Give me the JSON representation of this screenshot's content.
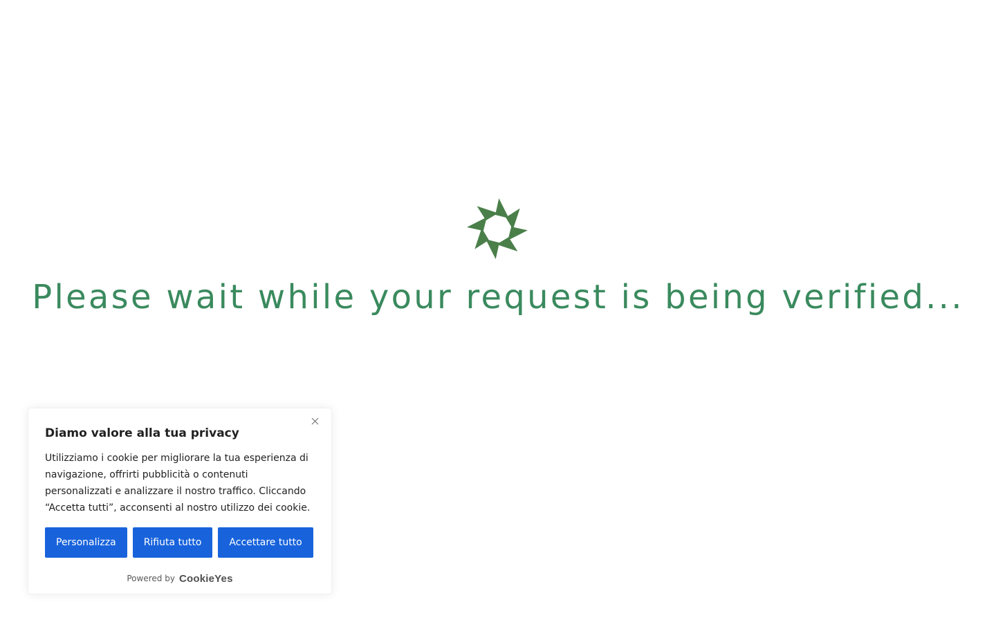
{
  "colors": {
    "accent_green": "#3a8a5e",
    "loader_green": "#4a7f4a",
    "button_blue": "#1863dc",
    "text_dark": "#212121",
    "close_gray": "#757575"
  },
  "loader": {
    "icon": "spinner-icon"
  },
  "verification": {
    "message": "Please wait while your request is being verified..."
  },
  "cookie_banner": {
    "title": "Diamo valore alla tua privacy",
    "description": "Utilizziamo i cookie per migliorare la tua esperienza di navigazione, offrirti pubblicità o contenuti personalizzati e analizzare il nostro traffico. Cliccando “Accetta tutti”, acconsenti al nostro utilizzo dei cookie.",
    "close_icon": "close-icon",
    "buttons": {
      "customize": "Personalizza",
      "reject_all": "Rifiuta tutto",
      "accept_all": "Accettare tutto"
    },
    "powered_by": "Powered by",
    "brand": "CookieYes"
  }
}
